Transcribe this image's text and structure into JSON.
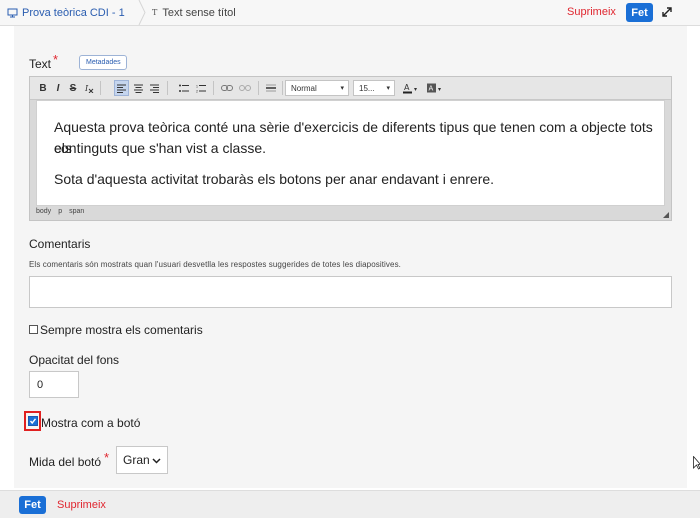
{
  "header": {
    "breadcrumb_parent": "Prova teòrica CDI - 1",
    "breadcrumb_current": "Text sense títol",
    "delete_label": "Suprimeix",
    "done_label": "Fet"
  },
  "form": {
    "text_label": "Text",
    "required_marker": "*",
    "metadata_label": "Metadades",
    "editor": {
      "toolbar": {
        "bold": "B",
        "italic": "I",
        "strike": "S",
        "format_select": "Normal",
        "size_select": "15..."
      },
      "paragraphs": [
        "Aquesta prova teòrica conté una sèrie d'exercicis de diferents tipus que tenen com a objecte tots els",
        "continguts que s'han vist a classe.",
        "Sota d'aquesta activitat trobaràs els botons per anar endavant i enrere."
      ],
      "status_path": [
        "body",
        "p",
        "span"
      ]
    },
    "comments_label": "Comentaris",
    "comments_help": "Els comentaris són mostrats quan l'usuari desvetlla les respostes suggerides de totes les diapositives.",
    "comments_value": "",
    "always_show_label": "Sempre mostra els comentaris",
    "always_show_checked": false,
    "opacity_label": "Opacitat del fons",
    "opacity_value": "0",
    "show_as_button_label": "Mostra com a botó",
    "show_as_button_checked": true,
    "button_size_label": "Mida del botó",
    "button_size_value": "Gran"
  },
  "footer": {
    "done_label": "Fet",
    "delete_label": "Suprimeix"
  },
  "colors": {
    "accent": "#1a6fd6",
    "danger": "#e0262f",
    "link": "#2a5db0"
  }
}
